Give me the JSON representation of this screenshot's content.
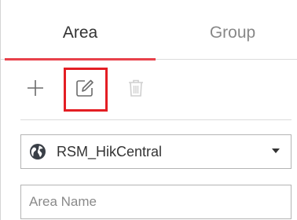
{
  "tabs": [
    {
      "label": "Area",
      "active": true
    },
    {
      "label": "Group",
      "active": false
    }
  ],
  "toolbar": {
    "add_icon": "plus-icon",
    "edit_icon": "edit-icon",
    "delete_icon": "trash-icon",
    "highlighted": "edit"
  },
  "site_select": {
    "icon": "globe-icon",
    "value": "RSM_HikCentral"
  },
  "area_name_input": {
    "value": "",
    "placeholder": "Area Name"
  },
  "colors": {
    "accent": "#e8414b",
    "highlight": "#e31e24",
    "globe": "#3a3f47"
  }
}
